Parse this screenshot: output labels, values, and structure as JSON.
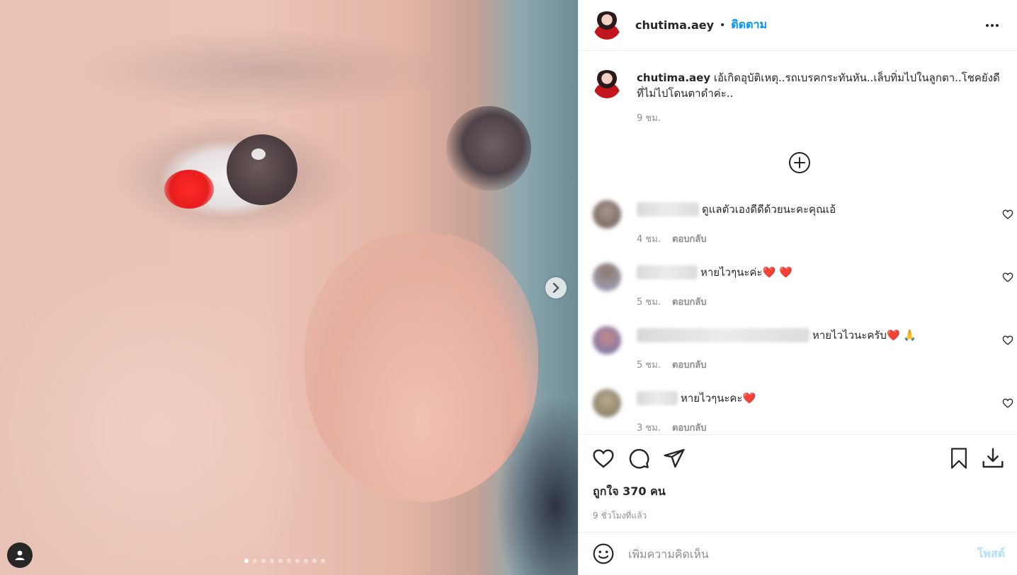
{
  "post": {
    "username": "chutima.aey",
    "follow_label": "ติดตาม",
    "caption": "เอ้เกิดอุบัติเหตุ..รถเบรคกระทันหัน..เล็บทิ่มไปในลูกตา..โชคยังดีที่ไม่ไปโดนตาดำค่ะ..",
    "caption_time": "9 ชม.",
    "likes": "ถูกใจ 370 คน",
    "posted_ago": "9 ชั่วโมงที่แล้ว",
    "carousel": {
      "total_slides": 10,
      "current_slide": 1
    }
  },
  "comments": [
    {
      "text": "ดูแลตัวเองดีดีด้วยนะคะคุณเอ้",
      "time": "4 ชม.",
      "reply": "ตอบกลับ"
    },
    {
      "text": "หายไวๆนะค่ะ❤️ ❤️",
      "time": "5 ชม.",
      "reply": "ตอบกลับ"
    },
    {
      "text": "หายไวไวนะครับ❤️ 🙏",
      "time": "5 ชม.",
      "reply": "ตอบกลับ"
    },
    {
      "text": "หายไวๆนะคะ❤️",
      "time": "3 ชม.",
      "reply": "ตอบกลับ"
    }
  ],
  "composer": {
    "placeholder": "เพิ่มความคิดเห็น",
    "post_label": "โพสต์"
  },
  "colors": {
    "accent": "#0095f6",
    "text": "#262626",
    "muted": "#8e8e8e",
    "post_disabled": "#b2dffc"
  },
  "icons": [
    "more-icon",
    "add-circle-icon",
    "heart-icon",
    "comment-icon",
    "share-icon",
    "bookmark-icon",
    "download-icon",
    "emoji-icon",
    "chevron-right-icon",
    "user-tag-icon"
  ]
}
